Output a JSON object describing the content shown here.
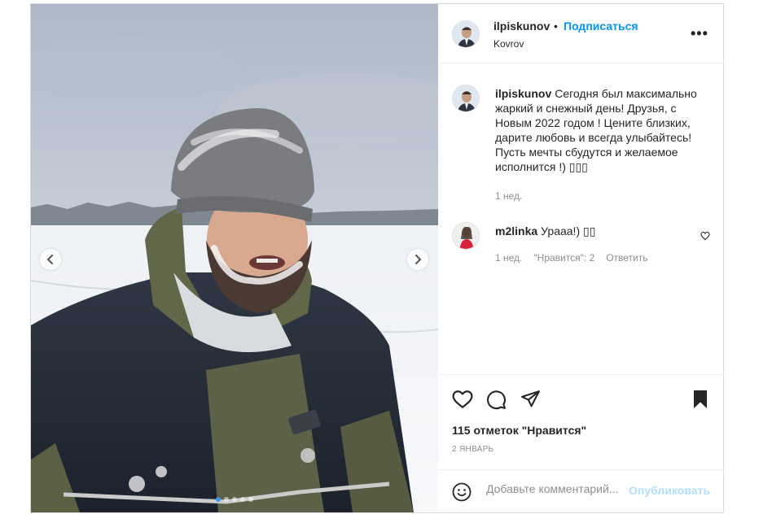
{
  "post": {
    "username": "ilpiskunov",
    "separator": "•",
    "follow_label": "Подписаться",
    "location": "Kovrov",
    "more_label": "•••",
    "caption": "Сегодня был максимально жаркий и снежный день! Друзья, с Новым 2022 годом ! Цените близких, дарите любовь и всегда улыбайтесь! Пусть мечты сбудутся и желаемое исполнится !) ▯▯▯",
    "caption_time": "1 нед.",
    "carousel": {
      "slide_count": 5,
      "active_index": 0
    }
  },
  "comment": {
    "username": "m2linka",
    "text": "Урааа!) ▯▯",
    "time": "1 нед.",
    "likes": "\"Нравится\": 2",
    "reply_label": "Ответить"
  },
  "actions": {
    "likes_text": "115 отметок \"Нравится\"",
    "date": "2 ЯНВАРЬ",
    "comment_placeholder": "Добавьте комментарий...",
    "publish_label": "Опубликовать"
  },
  "colors": {
    "link_blue": "#0095f6",
    "publish_disabled": "#b2dffc",
    "muted_text": "#8e8e8e"
  },
  "icons": {
    "heart": "heart-icon",
    "comment": "comment-icon",
    "share": "paper-plane-icon",
    "save": "bookmark-icon",
    "emoji": "smiley-icon",
    "more": "more-icon",
    "prev": "chevron-left-icon",
    "next": "chevron-right-icon"
  }
}
